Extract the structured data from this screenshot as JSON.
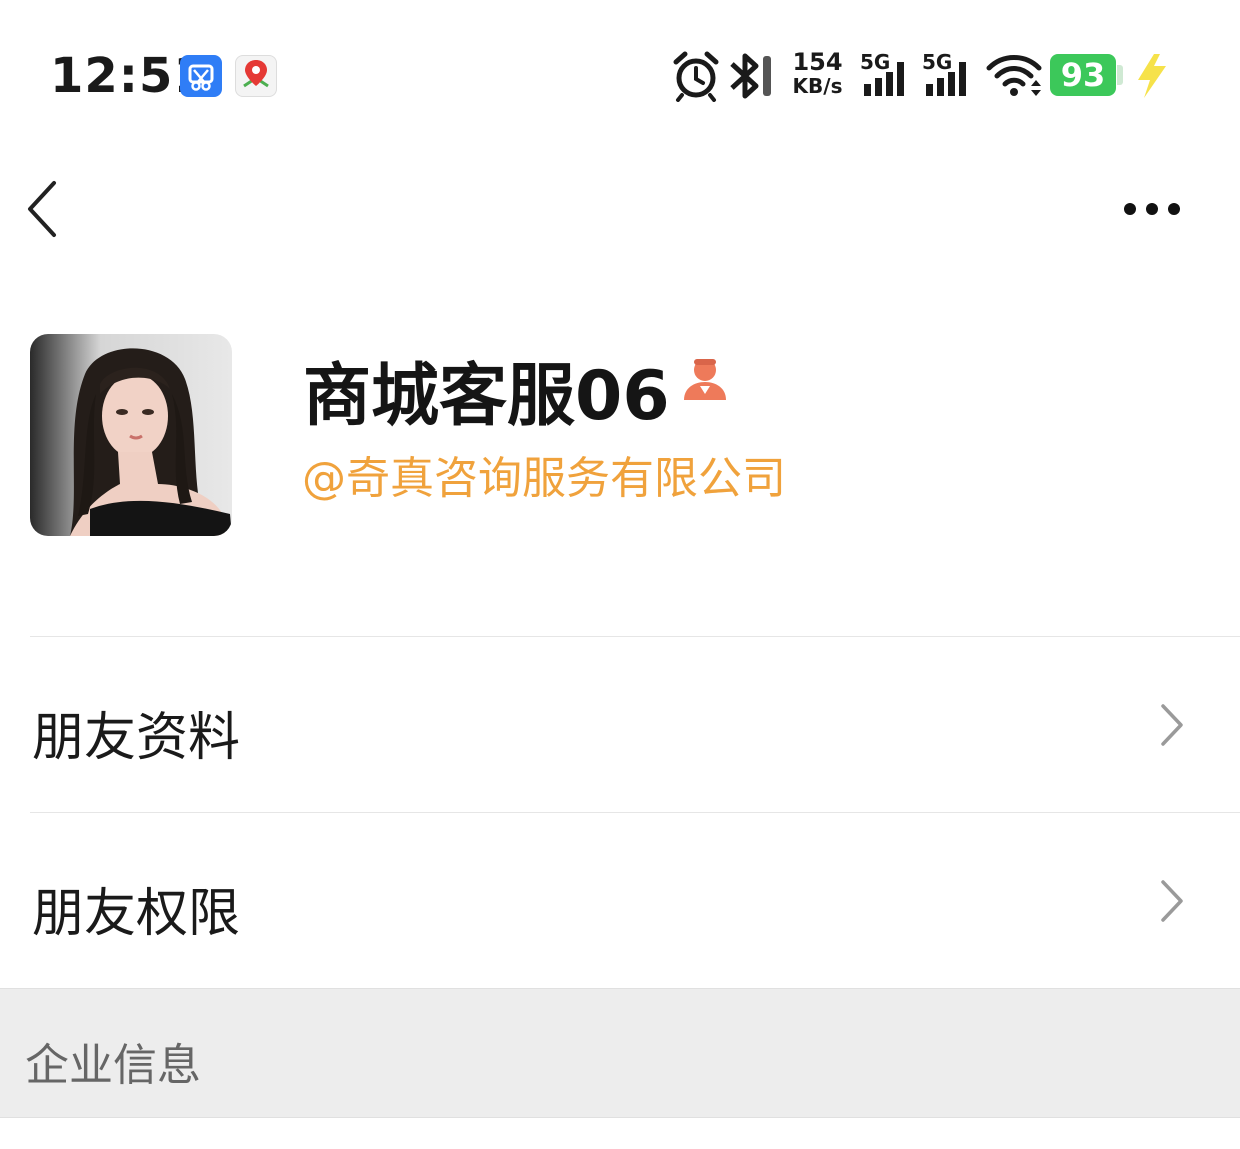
{
  "status_bar": {
    "time": "12:51",
    "net_speed_value": "154",
    "net_speed_unit": "KB/s",
    "signal_1_label": "5G",
    "signal_2_label": "5G",
    "battery": "93",
    "icons": [
      "screenshot-app-icon",
      "baidu-map-icon",
      "alarm-icon",
      "bluetooth-icon",
      "signal-icon",
      "wifi-icon",
      "battery-icon",
      "charging-icon"
    ]
  },
  "nav": {
    "back_icon": "chevron-left-icon",
    "more_icon": "ellipsis-icon"
  },
  "profile": {
    "name": "商城客服06",
    "company": "@奇真咨询服务有限公司",
    "badge_icon": "staff-icon",
    "badge_color": "#ee7a5a",
    "company_color": "#f0a23c"
  },
  "menu": {
    "items": [
      {
        "label": "朋友资料"
      },
      {
        "label": "朋友权限"
      }
    ]
  },
  "section": {
    "title": "企业信息"
  }
}
